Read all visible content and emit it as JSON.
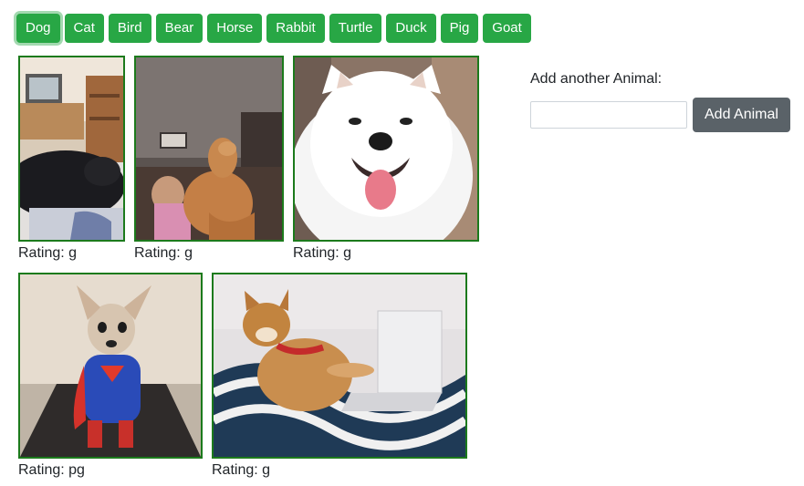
{
  "animals": [
    "Dog",
    "Cat",
    "Bird",
    "Bear",
    "Horse",
    "Rabbit",
    "Turtle",
    "Duck",
    "Pig",
    "Goat"
  ],
  "active_animal": "Dog",
  "gifs": [
    {
      "rating_label": "Rating: g"
    },
    {
      "rating_label": "Rating: g"
    },
    {
      "rating_label": "Rating: g"
    },
    {
      "rating_label": "Rating: pg"
    },
    {
      "rating_label": "Rating: g"
    }
  ],
  "add_form": {
    "label": "Add another Animal:",
    "input_value": "",
    "input_placeholder": "",
    "button_label": "Add Animal"
  },
  "colors": {
    "animal_button": "#28a745",
    "add_button": "#5a6268",
    "gif_border": "#1c7a1c"
  }
}
